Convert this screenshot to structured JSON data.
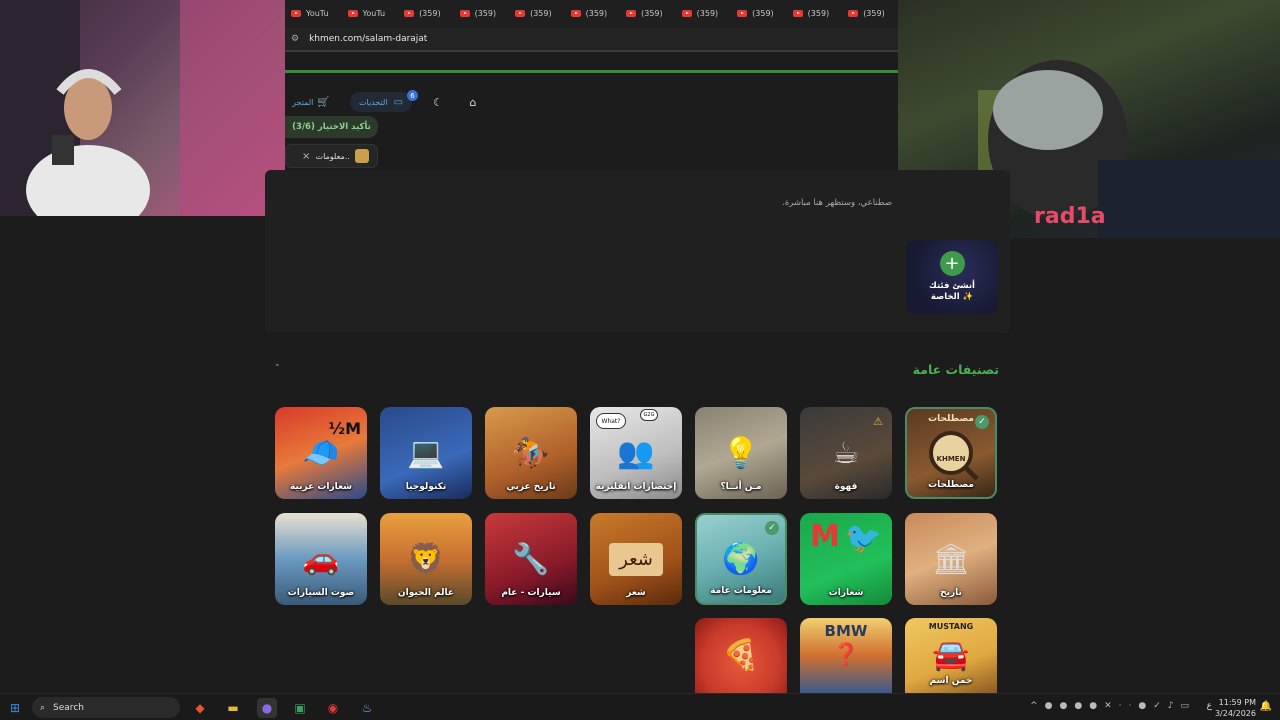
{
  "browser": {
    "tabs": [
      {
        "label": "YouTu"
      },
      {
        "label": "YouTu"
      },
      {
        "label": "(359)"
      },
      {
        "label": "(359)"
      },
      {
        "label": "(359)"
      },
      {
        "label": "(359)"
      },
      {
        "label": "(359)"
      },
      {
        "label": "(359)"
      },
      {
        "label": "(359)"
      },
      {
        "label": "(359)"
      },
      {
        "label": "(359)"
      }
    ],
    "url": "khmen.com/salam-darajat"
  },
  "header": {
    "store_label": "المتجر",
    "challenges_label": "التحديات",
    "challenges_badge": "6"
  },
  "selection": {
    "confirm_label": "تأكيد الاختيار (3/6)",
    "chip_label": "معلومات..",
    "chip_close": "×",
    "description": "صطناعي، وستظهر هنا مباشرة."
  },
  "create_category": {
    "plus": "+",
    "label": "أنشئ فئتك الخاصة ✨"
  },
  "general_section": {
    "title": "تصنيفات عامة",
    "collapse_icon": "˄",
    "row1": [
      {
        "label": "مصطلحات",
        "selected": true,
        "top_text": "مصطلحات",
        "sub_text": "KHMEN"
      },
      {
        "label": "قهوة",
        "warning": true
      },
      {
        "label": "مـن أنــا؟"
      },
      {
        "label": "إختصارات انقليزية",
        "bubble1": "What?",
        "bubble2": "G2G"
      },
      {
        "label": "تاريخ عربي"
      },
      {
        "label": "تكنولوجيا"
      },
      {
        "label": "شعارات عربية",
        "badge_text": "½M"
      }
    ],
    "row2": [
      {
        "label": "تاريخ"
      },
      {
        "label": "شعارات"
      },
      {
        "label": "معلومات عامة",
        "selected": true
      },
      {
        "label": "شعر",
        "art_text": "شعر"
      },
      {
        "label": "سيارات - عام"
      },
      {
        "label": "عالم الحيوان"
      },
      {
        "label": "صوت السيارات"
      }
    ],
    "row3": [
      {
        "label": "خمن اسم",
        "top_text": "MUSTANG"
      },
      {
        "label": "",
        "top_text": "BMW"
      },
      {
        "label": ""
      }
    ]
  },
  "taskbar": {
    "search_placeholder": "Search",
    "time": "11:59 PM",
    "date": "3/24/2026",
    "lang": "ع"
  },
  "overlay": {
    "right_cam_text": "rad1a"
  }
}
